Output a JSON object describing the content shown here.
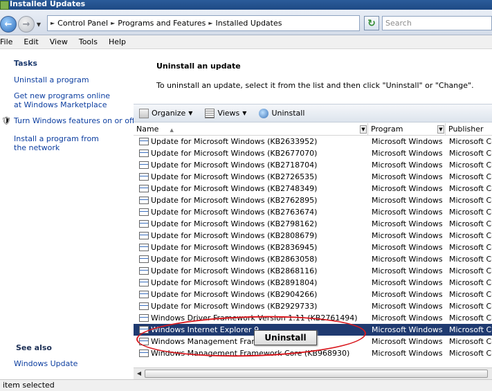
{
  "window": {
    "title": "Installed Updates"
  },
  "address": {
    "breadcrumbs": [
      "Control Panel",
      "Programs and Features",
      "Installed Updates"
    ],
    "search_placeholder": "Search"
  },
  "menu": [
    "File",
    "Edit",
    "View",
    "Tools",
    "Help"
  ],
  "tasks": {
    "title": "Tasks",
    "links": [
      "Uninstall a program",
      "Get new programs online at Windows Marketplace",
      "Turn Windows features on or off",
      "Install a program from the network"
    ]
  },
  "see_also": {
    "title": "See also",
    "links": [
      "Windows Update"
    ]
  },
  "header": {
    "title": "Uninstall an update",
    "description": "To uninstall an update, select it from the list and then click \"Uninstall\" or \"Change\"."
  },
  "toolbar": {
    "organize": "Organize",
    "views": "Views",
    "uninstall": "Uninstall"
  },
  "columns": [
    "Name",
    "Program",
    "Publisher"
  ],
  "rows": [
    {
      "name": "Update for Microsoft Windows (KB2633952)",
      "program": "Microsoft Windows",
      "publisher": "Microsoft Cor"
    },
    {
      "name": "Update for Microsoft Windows (KB2677070)",
      "program": "Microsoft Windows",
      "publisher": "Microsoft Cor"
    },
    {
      "name": "Update for Microsoft Windows (KB2718704)",
      "program": "Microsoft Windows",
      "publisher": "Microsoft Cor"
    },
    {
      "name": "Update for Microsoft Windows (KB2726535)",
      "program": "Microsoft Windows",
      "publisher": "Microsoft Cor"
    },
    {
      "name": "Update for Microsoft Windows (KB2748349)",
      "program": "Microsoft Windows",
      "publisher": "Microsoft Cor"
    },
    {
      "name": "Update for Microsoft Windows (KB2762895)",
      "program": "Microsoft Windows",
      "publisher": "Microsoft Cor"
    },
    {
      "name": "Update for Microsoft Windows (KB2763674)",
      "program": "Microsoft Windows",
      "publisher": "Microsoft Cor"
    },
    {
      "name": "Update for Microsoft Windows (KB2798162)",
      "program": "Microsoft Windows",
      "publisher": "Microsoft Cor"
    },
    {
      "name": "Update for Microsoft Windows (KB2808679)",
      "program": "Microsoft Windows",
      "publisher": "Microsoft Cor"
    },
    {
      "name": "Update for Microsoft Windows (KB2836945)",
      "program": "Microsoft Windows",
      "publisher": "Microsoft Cor"
    },
    {
      "name": "Update for Microsoft Windows (KB2863058)",
      "program": "Microsoft Windows",
      "publisher": "Microsoft Cor"
    },
    {
      "name": "Update for Microsoft Windows (KB2868116)",
      "program": "Microsoft Windows",
      "publisher": "Microsoft Cor"
    },
    {
      "name": "Update for Microsoft Windows (KB2891804)",
      "program": "Microsoft Windows",
      "publisher": "Microsoft Cor"
    },
    {
      "name": "Update for Microsoft Windows (KB2904266)",
      "program": "Microsoft Windows",
      "publisher": "Microsoft Cor"
    },
    {
      "name": "Update for Microsoft Windows (KB2929733)",
      "program": "Microsoft Windows",
      "publisher": "Microsoft Cor"
    },
    {
      "name": "Windows Driver Framework Version 1.11 (KB2761494)",
      "program": "Microsoft Windows",
      "publisher": "Microsoft Cor"
    },
    {
      "name": "Windows Internet Explorer 9",
      "program": "Microsoft Windows",
      "publisher": "Microsoft Cor",
      "selected": true
    },
    {
      "name": "Windows Management Framework",
      "program": "Microsoft Windows",
      "publisher": "Microsoft Cor"
    },
    {
      "name": "Windows Management Framework Core (KB968930)",
      "program": "Microsoft Windows",
      "publisher": "Microsoft Cor"
    }
  ],
  "context_button": "Uninstall",
  "status": "item selected",
  "colors": {
    "selection": "#1f3a70",
    "link": "#0c3ea0",
    "highlight_oval": "#d9181e"
  }
}
